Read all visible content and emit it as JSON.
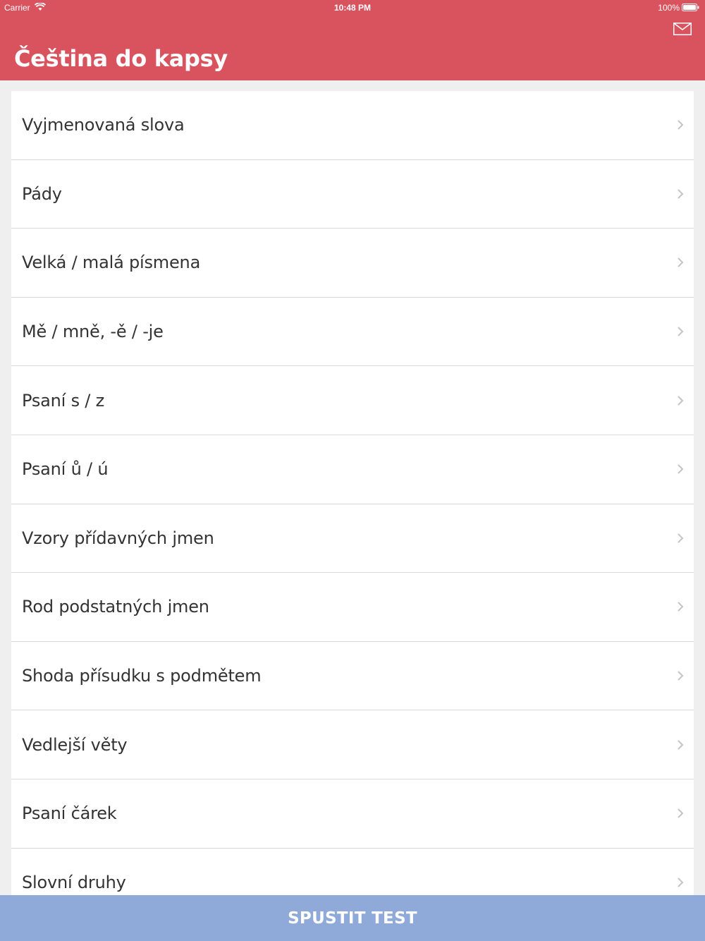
{
  "status_bar": {
    "carrier": "Carrier",
    "time": "10:48 PM",
    "battery": "100%",
    "icons": [
      "wifi-icon",
      "battery-icon"
    ]
  },
  "header": {
    "title": "Čeština do kapsy",
    "mail_icon": "mail-icon",
    "color": "#d9535f"
  },
  "list": {
    "items": [
      {
        "label": "Vyjmenovaná slova"
      },
      {
        "label": "Pády"
      },
      {
        "label": "Velká / malá písmena"
      },
      {
        "label": "Mě / mně, -ě / -je"
      },
      {
        "label": "Psaní s / z"
      },
      {
        "label": "Psaní ů / ú"
      },
      {
        "label": "Vzory přídavných jmen"
      },
      {
        "label": "Rod podstatných jmen"
      },
      {
        "label": "Shoda přísudku s podmětem"
      },
      {
        "label": "Vedlejší věty"
      },
      {
        "label": "Psaní čárek"
      },
      {
        "label": "Slovní druhy"
      }
    ],
    "chevron_icon": "chevron-right-icon"
  },
  "footer": {
    "start_label": "SPUSTIT TEST",
    "color": "#8fa9d9"
  }
}
